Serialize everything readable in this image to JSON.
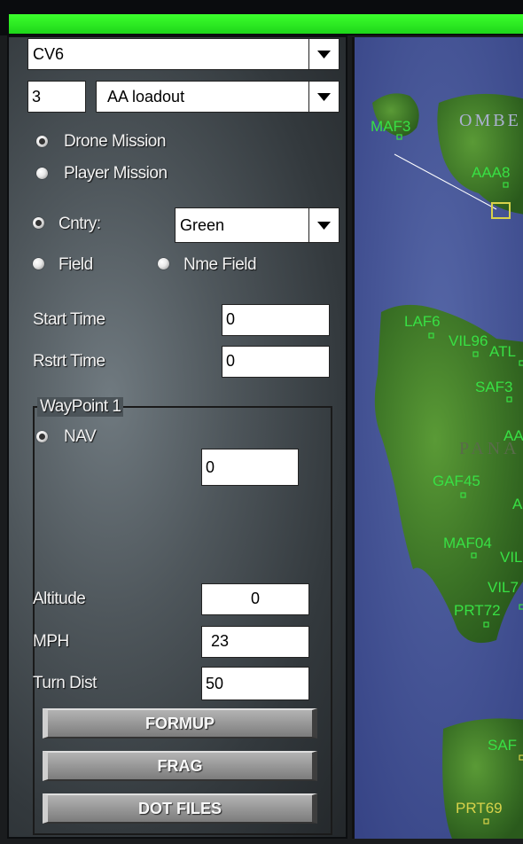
{
  "mission_panel": {
    "unit_select": "CV6",
    "loadout_number": "3",
    "loadout_select": "AA loadout",
    "drone_mission_label": "Drone Mission",
    "player_mission_label": "Player Mission",
    "country_label": "Cntry:",
    "country_select": "Green",
    "field_label": "Field",
    "enemy_field_label": "Nme Field",
    "start_time_label": "Start Time",
    "start_time_value": "0",
    "restart_time_label": "Rstrt Time",
    "restart_time_value": "0"
  },
  "waypoint": {
    "title": "WayPoint 1",
    "nav_label": "NAV",
    "nav_value": "0",
    "altitude_label": "Altitude",
    "altitude_value": "0",
    "mph_label": "MPH",
    "mph_value": "23",
    "turn_dist_label": "Turn Dist",
    "turn_dist_value": "50"
  },
  "buttons": {
    "formup": "FORMUP",
    "frag": "FRAG",
    "dot_files": "DOT FILES"
  },
  "map": {
    "region_labels": [
      "OMBE",
      "PANA"
    ],
    "markers": [
      "MAF3",
      "AAA8",
      "LAF6",
      "VIL96",
      "ATL",
      "SAF3",
      "AA",
      "GAF45",
      "A",
      "MAF04",
      "VIL",
      "VIL7",
      "PRT72",
      "SAF",
      "PRT69"
    ],
    "colors": {
      "marker_green": "#38e044",
      "marker_yellow": "#d8d24a",
      "sea": "#3f4e92",
      "land": "#3f7a2a"
    }
  }
}
